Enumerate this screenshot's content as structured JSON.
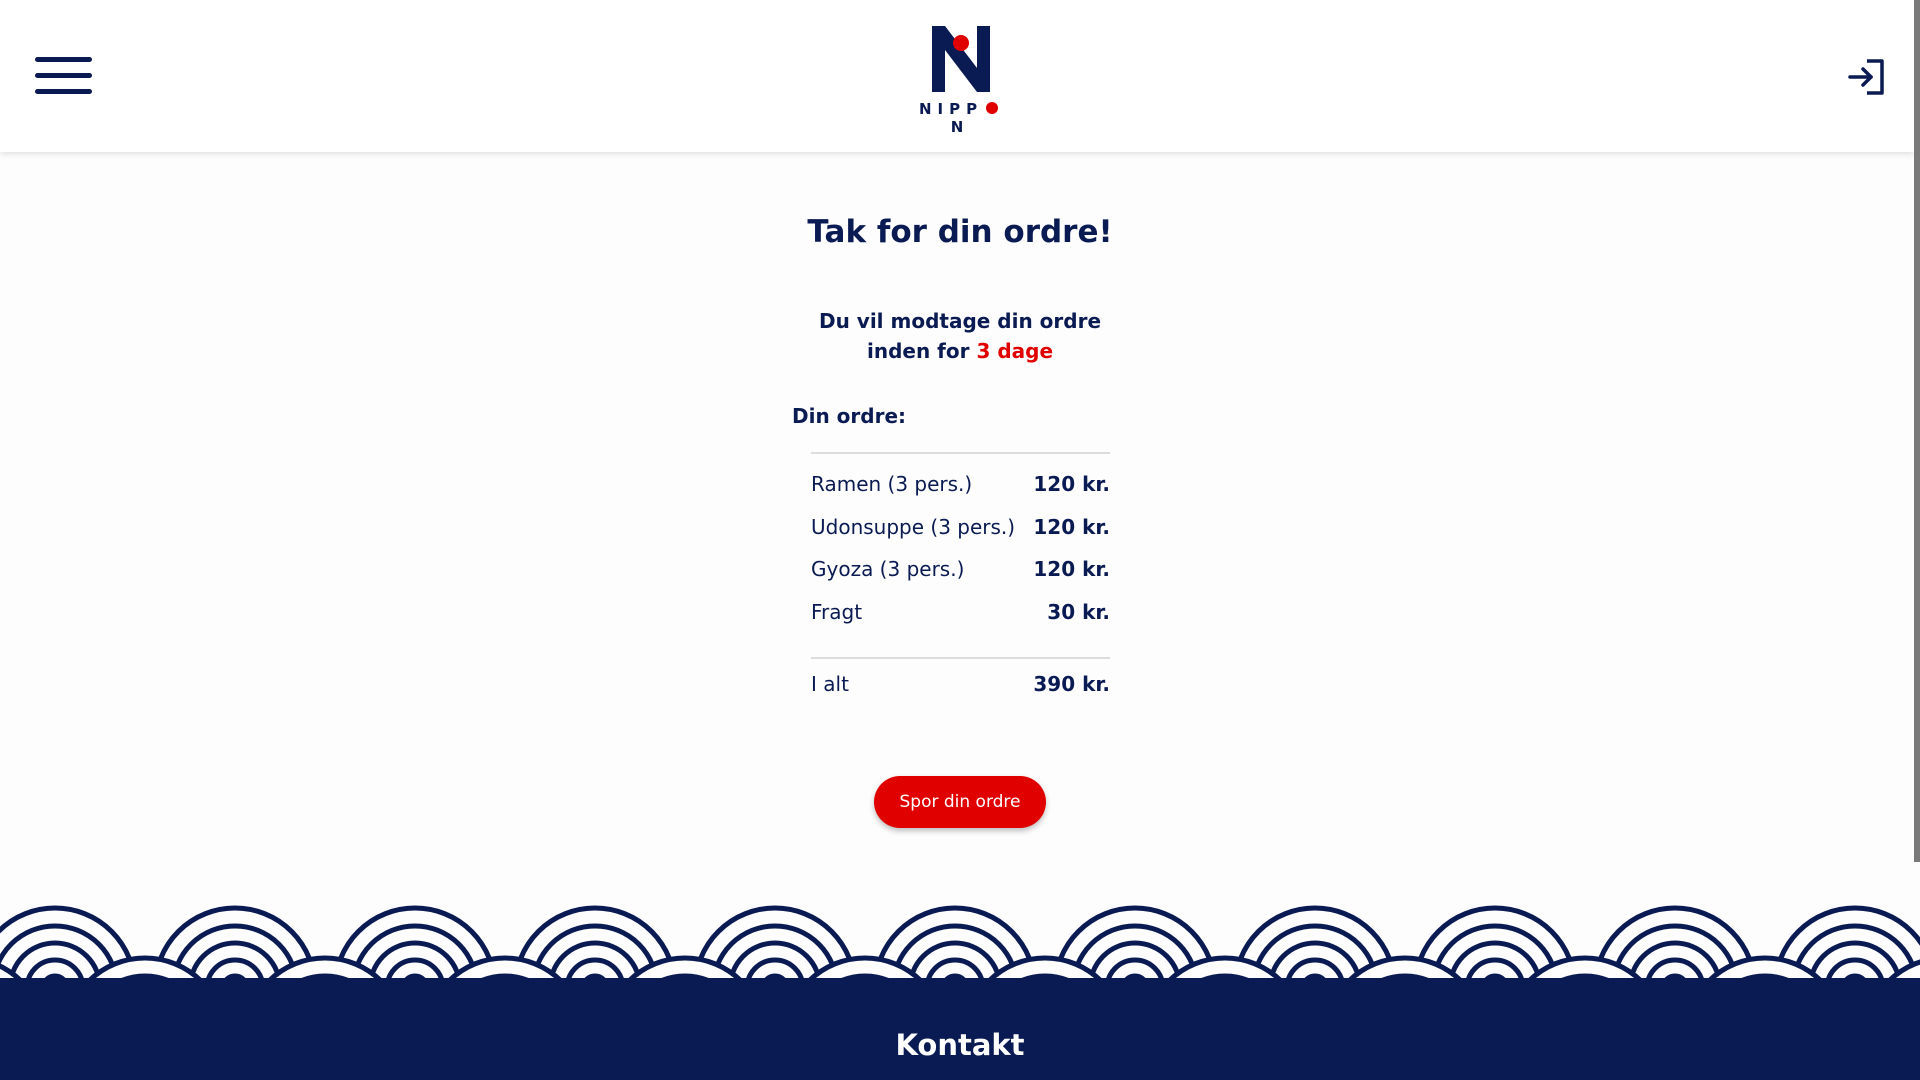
{
  "header": {
    "logo_text": "NIPPON",
    "logo_letters_before_dot": "NIPP",
    "logo_letters_after_dot": "N",
    "menu_icon": "hamburger-menu-icon",
    "login_icon": "sign-in-icon"
  },
  "confirmation": {
    "title": "Tak for din ordre!",
    "delivery_line1": "Du vil modtage din ordre",
    "delivery_prefix": "inden for",
    "delivery_days": "3 dage"
  },
  "order": {
    "label": "Din ordre:",
    "items": [
      {
        "name": "Ramen (3 pers.)",
        "price": "120 kr."
      },
      {
        "name": "Udonsuppe (3 pers.)",
        "price": "120 kr."
      },
      {
        "name": "Gyoza (3 pers.)",
        "price": "120 kr."
      },
      {
        "name": "Fragt",
        "price": "30 kr."
      }
    ],
    "total_label": "I alt",
    "total_price": "390 kr."
  },
  "cta": {
    "label": "Spor din ordre"
  },
  "footer": {
    "title": "Kontakt"
  },
  "colors": {
    "navy": "#0a1a52",
    "red": "#e00000",
    "white": "#ffffff"
  }
}
